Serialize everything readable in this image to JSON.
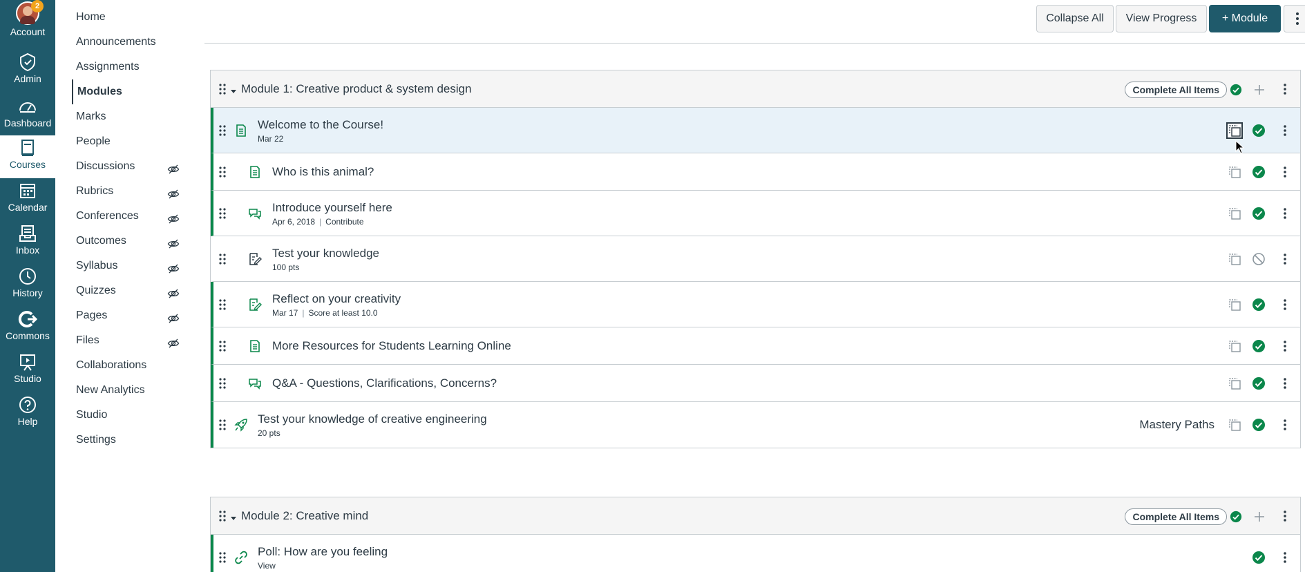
{
  "global_nav": {
    "account": {
      "label": "Account",
      "badge": "2",
      "icon": "avatar-icon"
    },
    "items": [
      {
        "label": "Admin",
        "icon": "shield-icon"
      },
      {
        "label": "Dashboard",
        "icon": "dashboard-icon"
      },
      {
        "label": "Courses",
        "icon": "courses-icon",
        "active": true
      },
      {
        "label": "Calendar",
        "icon": "calendar-icon"
      },
      {
        "label": "Inbox",
        "icon": "inbox-icon"
      },
      {
        "label": "History",
        "icon": "clock-icon"
      },
      {
        "label": "Commons",
        "icon": "commons-icon"
      },
      {
        "label": "Studio",
        "icon": "studio-icon"
      },
      {
        "label": "Help",
        "icon": "help-icon"
      }
    ]
  },
  "course_nav": {
    "items": [
      {
        "label": "Home"
      },
      {
        "label": "Announcements"
      },
      {
        "label": "Assignments"
      },
      {
        "label": "Modules",
        "active": true
      },
      {
        "label": "Marks"
      },
      {
        "label": "People"
      },
      {
        "label": "Discussions",
        "hidden": true
      },
      {
        "label": "Rubrics",
        "hidden": true
      },
      {
        "label": "Conferences",
        "hidden": true
      },
      {
        "label": "Outcomes",
        "hidden": true
      },
      {
        "label": "Syllabus",
        "hidden": true
      },
      {
        "label": "Quizzes",
        "hidden": true
      },
      {
        "label": "Pages",
        "hidden": true
      },
      {
        "label": "Files",
        "hidden": true
      },
      {
        "label": "Collaborations"
      },
      {
        "label": "New Analytics"
      },
      {
        "label": "Studio"
      },
      {
        "label": "Settings"
      }
    ]
  },
  "toolbar": {
    "collapse_all": "Collapse All",
    "view_progress": "View Progress",
    "add_module": "+ Module"
  },
  "modules": [
    {
      "title": "Module 1: Creative product & system design",
      "complete_all": "Complete All Items",
      "items": [
        {
          "title": "Welcome to the Course!",
          "meta": [
            "Mar 22"
          ],
          "type": "page",
          "status": "published",
          "selected": true
        },
        {
          "title": "Who is this animal?",
          "meta": [],
          "type": "page",
          "status": "published"
        },
        {
          "title": "Introduce yourself here",
          "meta": [
            "Apr 6, 2018",
            "Contribute"
          ],
          "type": "discussion",
          "status": "published"
        },
        {
          "title": "Test your knowledge",
          "meta": [
            "100 pts"
          ],
          "type": "quiz",
          "status": "unpublished"
        },
        {
          "title": "Reflect on your creativity",
          "meta": [
            "Mar 17",
            "Score at least 10.0"
          ],
          "type": "assignment",
          "status": "published"
        },
        {
          "title": "More Resources for Students Learning Online",
          "meta": [],
          "type": "page",
          "status": "published"
        },
        {
          "title": "Q&A - Questions, Clarifications, Concerns?",
          "meta": [],
          "type": "discussion",
          "status": "published"
        },
        {
          "title": "Test your knowledge of creative engineering",
          "meta": [
            "20 pts"
          ],
          "type": "quiz",
          "status": "published",
          "mastery": "Mastery Paths"
        }
      ]
    },
    {
      "title": "Module 2: Creative mind",
      "complete_all": "Complete All Items",
      "items": [
        {
          "title": "Poll: How are you feeling",
          "meta": [
            "View"
          ],
          "type": "link",
          "status": "published"
        }
      ]
    }
  ],
  "colors": {
    "nav_bg": "#1f5a6b",
    "published": "#0b874b",
    "primary_button": "#1f5a6b",
    "row_selected": "#e8f2f9"
  }
}
